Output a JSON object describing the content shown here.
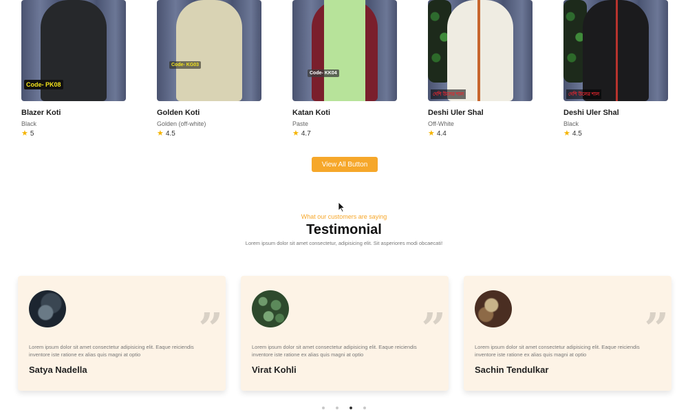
{
  "products": [
    {
      "name": "Blazer Koti",
      "color": "Black",
      "rating": "5",
      "code": "Code- PK08"
    },
    {
      "name": "Golden Koti",
      "color": "Golden (off-white)",
      "rating": "4.5",
      "code": "Code- KG03"
    },
    {
      "name": "Katan Koti",
      "color": "Paste",
      "rating": "4.7",
      "code": "Code- KK04"
    },
    {
      "name": "Deshi Uler Shal",
      "color": "Off-White",
      "rating": "4.4",
      "code": ""
    },
    {
      "name": "Deshi Uler Shal",
      "color": "Black",
      "rating": "4.5",
      "code": ""
    }
  ],
  "view_all_label": "View All Button",
  "testimonial": {
    "eyebrow": "What our customers are saying",
    "title": "Testimonial",
    "subtitle": "Lorem ipsum dolor sit amet consectetur, adipisicing elit. Sit asperiores modi obcaecati!",
    "cards": [
      {
        "text": "Lorem ipsum dolor sit amet consectetur adipisicing elit. Eaque reiciendis inventore iste ratione ex alias quis magni at optio",
        "name": "Satya Nadella"
      },
      {
        "text": "Lorem ipsum dolor sit amet consectetur adipisicing elit. Eaque reiciendis inventore iste ratione ex alias quis magni at optio",
        "name": "Virat Kohli"
      },
      {
        "text": "Lorem ipsum dolor sit amet consectetur adipisicing elit. Eaque reiciendis inventore iste ratione ex alias quis magni at optio",
        "name": "Sachin Tendulkar"
      }
    ]
  },
  "carousel": {
    "total_dots": 4,
    "active_dot_index": 2
  },
  "colors": {
    "accent": "#f6a72a",
    "card_bg": "#fdf3e6",
    "star": "#f5b400"
  },
  "icons": {
    "rating": "star-icon",
    "quote": "quote-icon",
    "cursor": "mouse-cursor-icon"
  }
}
